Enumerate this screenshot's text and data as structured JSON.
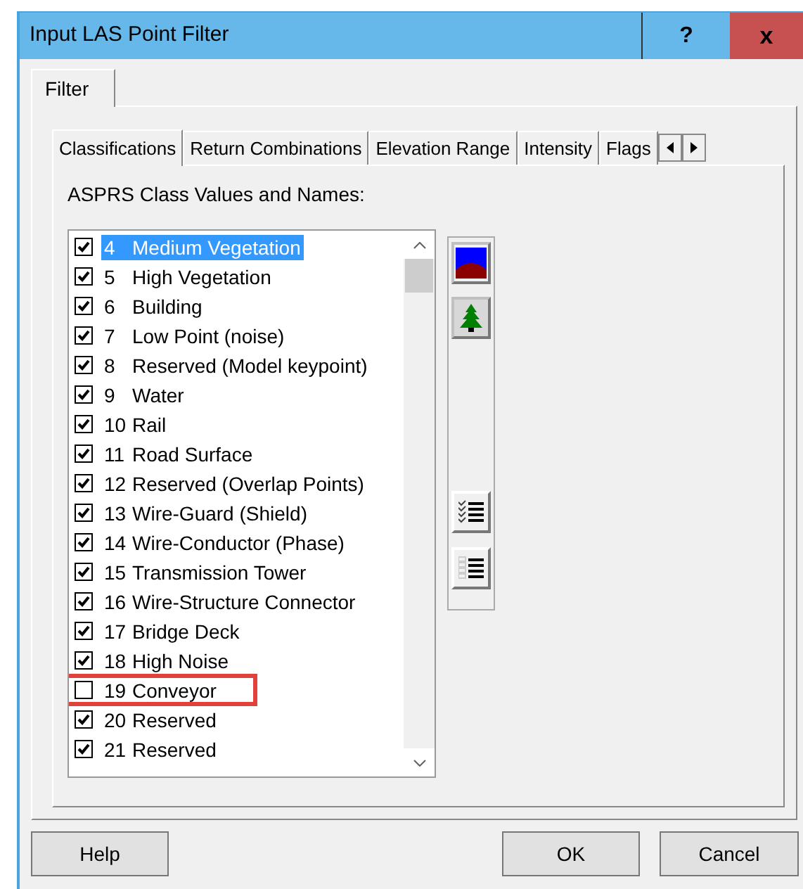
{
  "window": {
    "title": "Input LAS Point Filter",
    "help": "?",
    "close": "x"
  },
  "outer_tabs": [
    {
      "label": "Filter",
      "selected": true
    }
  ],
  "tabs": [
    {
      "label": "Classifications",
      "selected": true
    },
    {
      "label": "Return Combinations",
      "selected": false
    },
    {
      "label": "Elevation Range",
      "selected": false
    },
    {
      "label": "Intensity",
      "selected": false
    },
    {
      "label": "Flags",
      "selected": false
    }
  ],
  "list_label": "ASPRS Class Values and Names:",
  "classes": [
    {
      "code": "4",
      "name": "Medium Vegetation",
      "checked": true,
      "selected": true,
      "highlighted": false
    },
    {
      "code": "5",
      "name": "High Vegetation",
      "checked": true,
      "selected": false,
      "highlighted": false
    },
    {
      "code": "6",
      "name": "Building",
      "checked": true,
      "selected": false,
      "highlighted": false
    },
    {
      "code": "7",
      "name": "Low Point (noise)",
      "checked": true,
      "selected": false,
      "highlighted": false
    },
    {
      "code": "8",
      "name": "Reserved (Model keypoint)",
      "checked": true,
      "selected": false,
      "highlighted": false
    },
    {
      "code": "9",
      "name": "Water",
      "checked": true,
      "selected": false,
      "highlighted": false
    },
    {
      "code": "10",
      "name": "Rail",
      "checked": true,
      "selected": false,
      "highlighted": false
    },
    {
      "code": "11",
      "name": "Road Surface",
      "checked": true,
      "selected": false,
      "highlighted": false
    },
    {
      "code": "12",
      "name": "Reserved (Overlap Points)",
      "checked": true,
      "selected": false,
      "highlighted": false
    },
    {
      "code": "13",
      "name": "Wire-Guard (Shield)",
      "checked": true,
      "selected": false,
      "highlighted": false
    },
    {
      "code": "14",
      "name": "Wire-Conductor (Phase)",
      "checked": true,
      "selected": false,
      "highlighted": false
    },
    {
      "code": "15",
      "name": "Transmission Tower",
      "checked": true,
      "selected": false,
      "highlighted": false
    },
    {
      "code": "16",
      "name": "Wire-Structure Connector",
      "checked": true,
      "selected": false,
      "highlighted": false
    },
    {
      "code": "17",
      "name": "Bridge Deck",
      "checked": true,
      "selected": false,
      "highlighted": false
    },
    {
      "code": "18",
      "name": "High Noise",
      "checked": true,
      "selected": false,
      "highlighted": false
    },
    {
      "code": "19",
      "name": "Conveyor",
      "checked": false,
      "selected": false,
      "highlighted": true
    },
    {
      "code": "20",
      "name": "Reserved",
      "checked": true,
      "selected": false,
      "highlighted": false
    },
    {
      "code": "21",
      "name": "Reserved",
      "checked": true,
      "selected": false,
      "highlighted": false
    }
  ],
  "buttons": [
    {
      "label": "Help",
      "kind": "help"
    },
    {
      "label": "OK",
      "kind": "ok"
    },
    {
      "label": "Cancel",
      "kind": "cancel"
    }
  ]
}
